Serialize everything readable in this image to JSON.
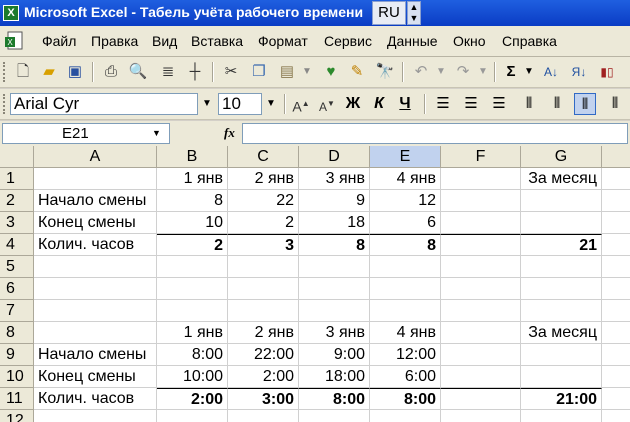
{
  "window": {
    "title": "Microsoft Excel - Табель учёта рабочего времени",
    "lang": "RU"
  },
  "menu": [
    "Файл",
    "Правка",
    "Вид",
    "Вставка",
    "Формат",
    "Сервис",
    "Данные",
    "Окно",
    "Справка"
  ],
  "format_toolbar": {
    "font_name": "Arial Cyr",
    "font_size": "10"
  },
  "formula_bar": {
    "name_box": "E21",
    "fx": "fx",
    "formula": ""
  },
  "columns": [
    "A",
    "B",
    "C",
    "D",
    "E",
    "F",
    "G"
  ],
  "rows": [
    [
      "",
      "1 янв",
      "2 янв",
      "3 янв",
      "4 янв",
      "",
      "За месяц"
    ],
    [
      "Начало смены",
      "8",
      "22",
      "9",
      "12",
      "",
      ""
    ],
    [
      "Конец смены",
      "10",
      "2",
      "18",
      "6",
      "",
      ""
    ],
    [
      "Колич. часов",
      "2",
      "3",
      "8",
      "8",
      "",
      "21"
    ],
    [
      "",
      "",
      "",
      "",
      "",
      "",
      ""
    ],
    [
      "",
      "",
      "",
      "",
      "",
      "",
      ""
    ],
    [
      "",
      "",
      "",
      "",
      "",
      "",
      ""
    ],
    [
      "",
      "1 янв",
      "2 янв",
      "3 янв",
      "4 янв",
      "",
      "За месяц"
    ],
    [
      "Начало смены",
      "8:00",
      "22:00",
      "9:00",
      "12:00",
      "",
      ""
    ],
    [
      "Конец смены",
      "10:00",
      "2:00",
      "18:00",
      "6:00",
      "",
      ""
    ],
    [
      "Колич. часов",
      "2:00",
      "3:00",
      "8:00",
      "8:00",
      "",
      "21:00"
    ],
    [
      "",
      "",
      "",
      "",
      "",
      "",
      ""
    ]
  ],
  "row_numbers": [
    "1",
    "2",
    "3",
    "4",
    "5",
    "6",
    "7",
    "8",
    "9",
    "10",
    "11",
    "12"
  ],
  "selected_column": "E",
  "colors": {
    "title_bar": "#1f5fe0",
    "header_bg": "#ece9d8",
    "selected_header": "#c1d2ee"
  }
}
